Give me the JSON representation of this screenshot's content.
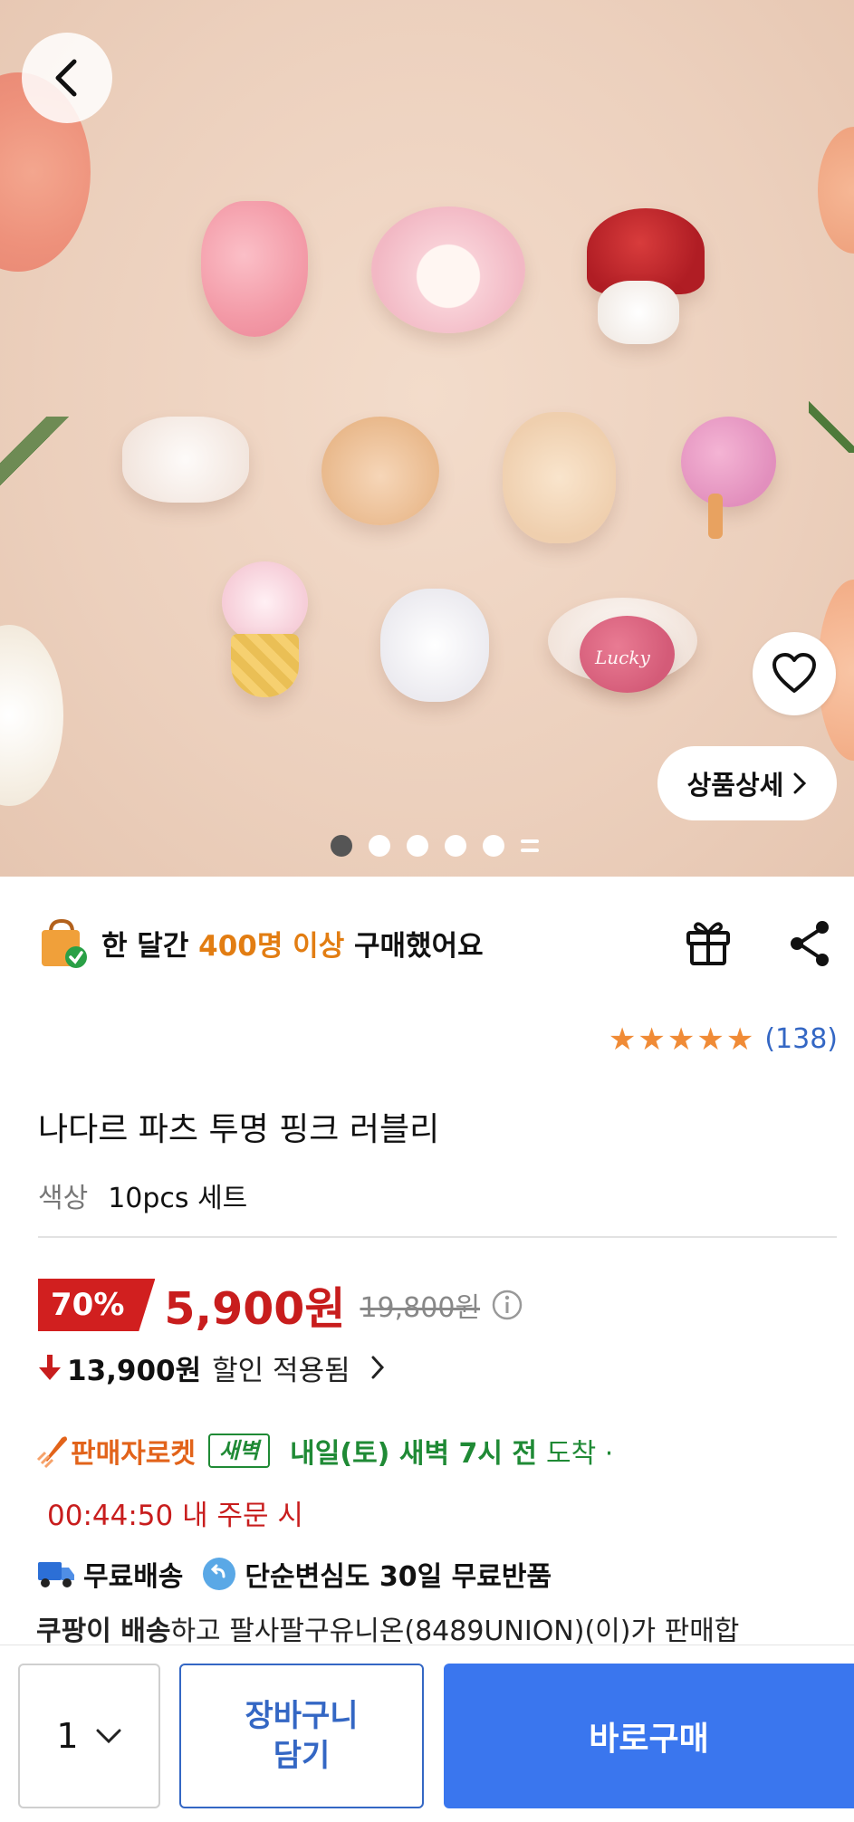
{
  "hero": {
    "image_alt": "",
    "charm_text": "Lucky",
    "detail_button": "상품상세",
    "carousel": {
      "total_dots": 5,
      "active_index": 0
    }
  },
  "purchase_stat": {
    "prefix": "한 달간 ",
    "highlight": "400명 이상",
    "suffix": " 구매했어요"
  },
  "rating": {
    "stars": 5,
    "count": "(138)"
  },
  "product": {
    "title": "나다르 파츠 투명 핑크 러블리",
    "option_label": "색상",
    "option_value": "10pcs 세트"
  },
  "price": {
    "discount": "70%",
    "sale": "5,900원",
    "original": "19,800원",
    "coupon_amount": "13,900원",
    "coupon_text": "할인 적용됨"
  },
  "delivery": {
    "rocket_label": "판매자로켓",
    "dawn_badge": "새벽",
    "arrival": "내일(토) 새벽 7시 전",
    "arrival_suffix": "도착 ·",
    "deadline": "00:44:50 내 주문 시",
    "free_shipping": "무료배송",
    "free_return": "단순변심도 30일 무료반품",
    "seller_bold": "쿠팡이 배송",
    "seller_rest": "하고 팔사팔구유니온(8489UNION)(이)가 판매합"
  },
  "bottom": {
    "quantity": "1",
    "cart_line1": "장바구니",
    "cart_line2": "담기",
    "buy_now": "바로구매"
  },
  "colors": {
    "discount_red": "#d11f1f",
    "rocket_orange": "#e2631a",
    "dawn_green": "#1f8a35",
    "link_blue": "#3467c4",
    "buy_blue": "#3a76ee",
    "star_orange": "#f08b36"
  },
  "icons": [
    "back-icon",
    "heart-icon",
    "chevron-right-icon",
    "shopping-bag-check-icon",
    "gift-icon",
    "share-icon",
    "star-icon",
    "info-icon",
    "arrow-down-icon",
    "rocket-icon",
    "truck-icon",
    "return-icon",
    "chevron-down-icon"
  ]
}
